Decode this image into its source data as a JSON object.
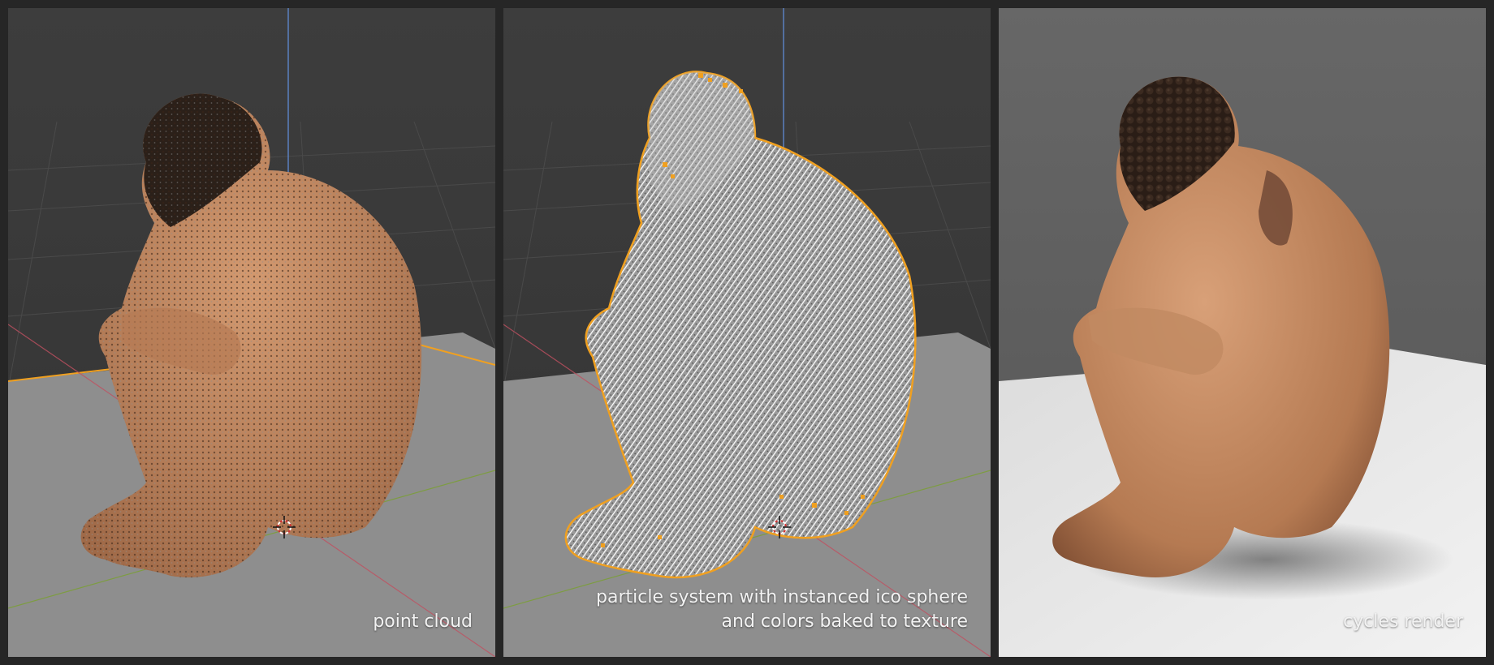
{
  "panels": [
    {
      "caption": "point cloud",
      "view": "viewport",
      "style": "point-cloud"
    },
    {
      "caption": "particle system with instanced ico sphere\nand colors baked to texture",
      "view": "viewport",
      "style": "particle-wireframe"
    },
    {
      "caption": "cycles render",
      "view": "render",
      "style": "rendered"
    }
  ],
  "colors": {
    "viewport_bg": "#3a3a3a",
    "floor": "#8e8e8e",
    "skin": "#c48a62",
    "hair": "#2b2019",
    "selection_outline": "#f0a020",
    "axis_x": "#c05060",
    "axis_y": "#7aa030",
    "axis_z": "#5a80c0",
    "render_bg": "#5f5f5f",
    "render_floor": "#e6e6e6"
  },
  "icons": [
    "3d-cursor-icon"
  ]
}
